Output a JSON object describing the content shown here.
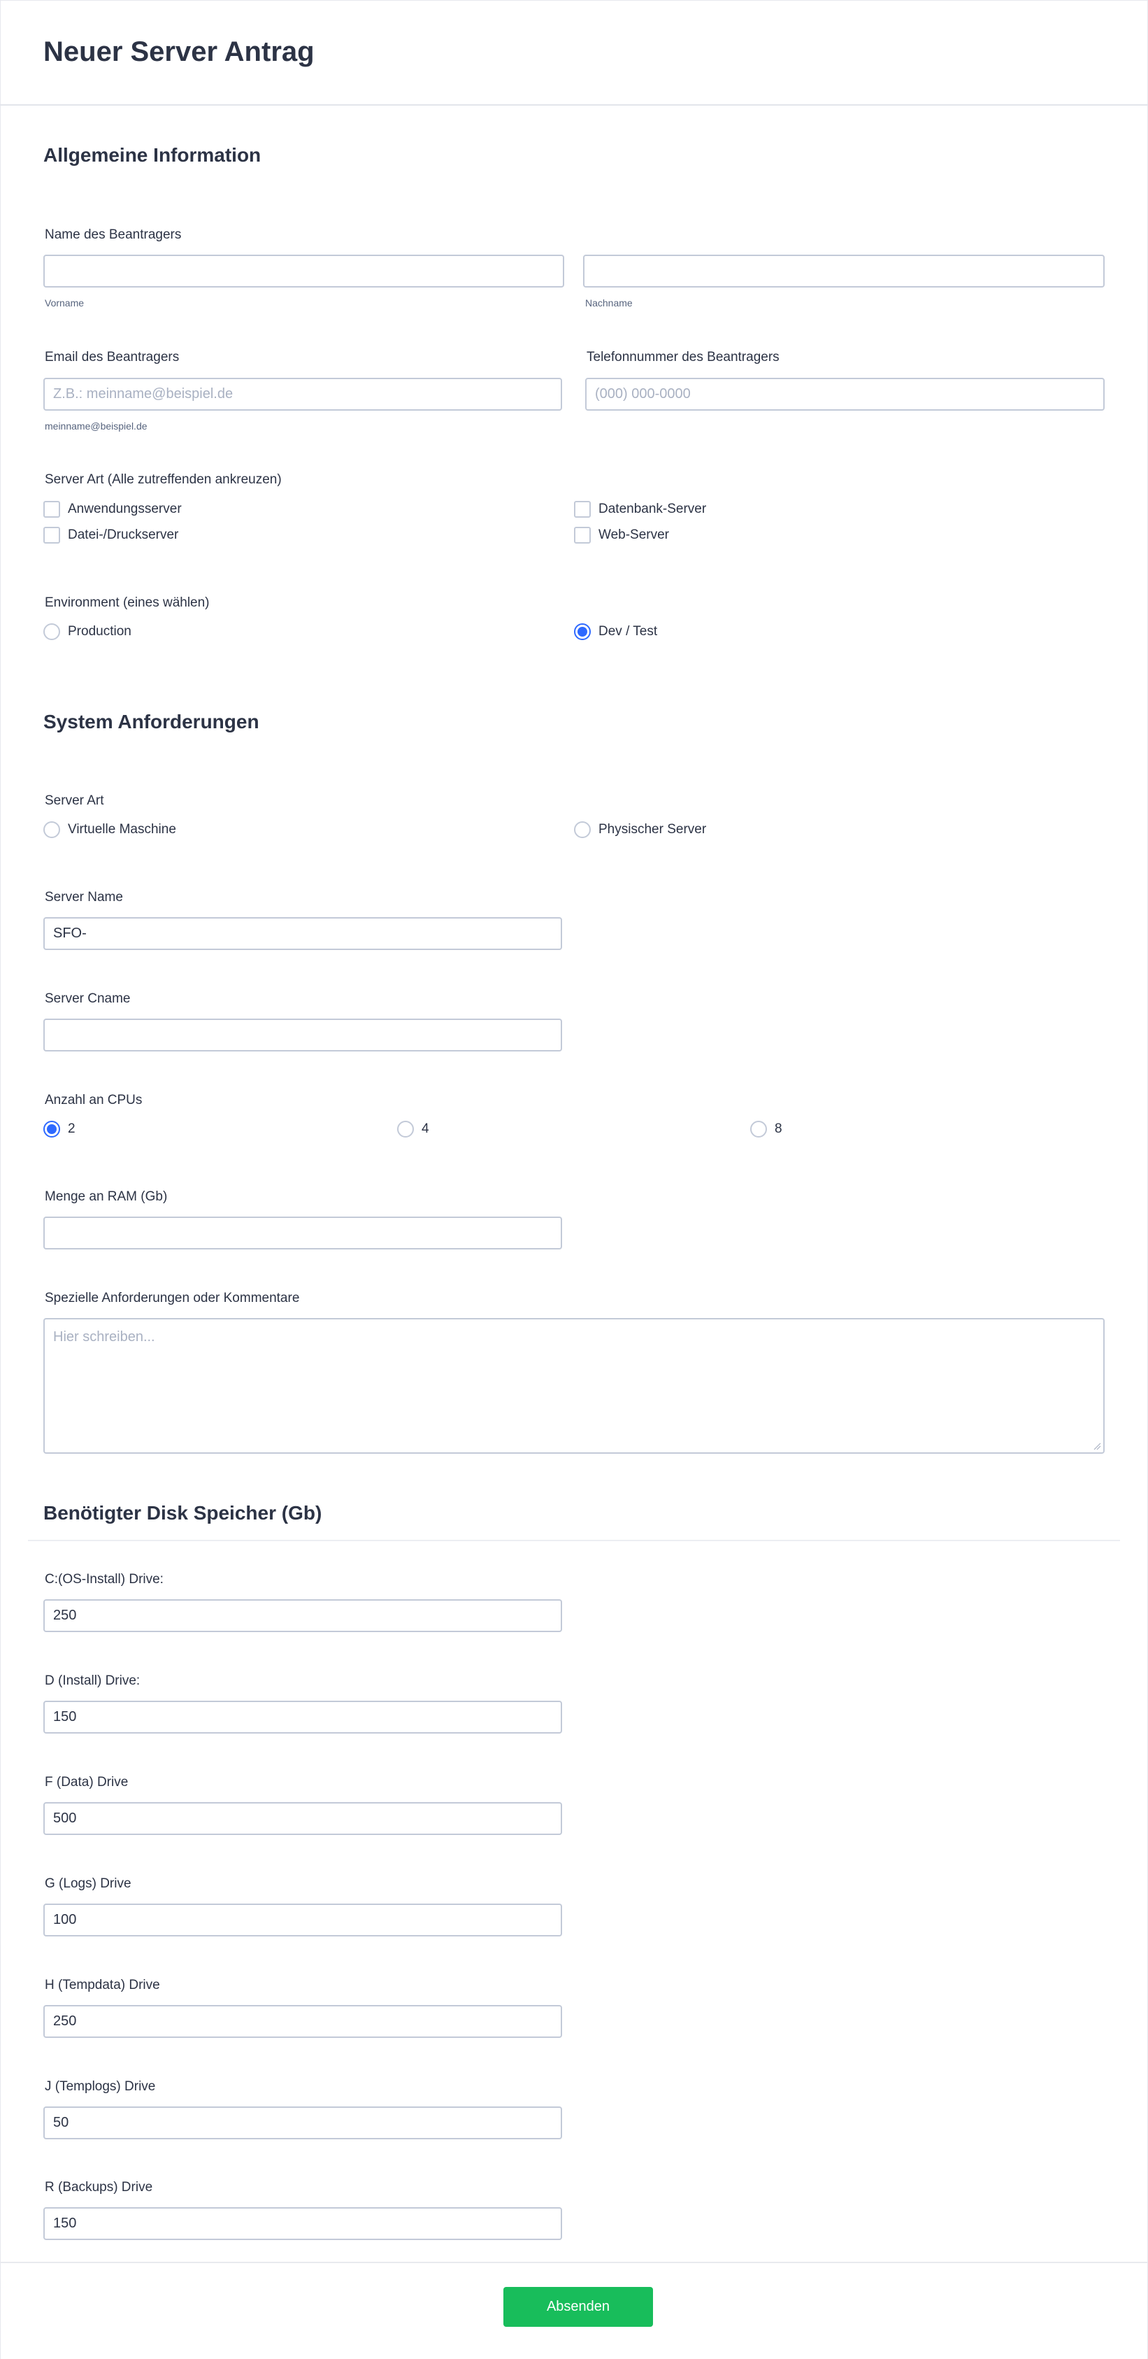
{
  "header": {
    "title": "Neuer Server Antrag"
  },
  "general": {
    "title": "Allgemeine Information",
    "name": {
      "label": "Name des Beantragers",
      "first_value": "",
      "last_value": "",
      "first_sublabel": "Vorname",
      "last_sublabel": "Nachname"
    },
    "email": {
      "label": "Email des Beantragers",
      "value": "",
      "placeholder": "Z.B.: meinname@beispiel.de",
      "sublabel": "meinname@beispiel.de"
    },
    "phone": {
      "label": "Telefonnummer des Beantragers",
      "value": "",
      "placeholder": "(000) 000-0000"
    },
    "server_type": {
      "label": "Server Art (Alle zutreffenden ankreuzen)",
      "options": [
        "Anwendungsserver",
        "Datenbank-Server",
        "Datei-/Druckserver",
        "Web-Server"
      ],
      "checked": [
        false,
        false,
        false,
        false
      ]
    },
    "environment": {
      "label": "Environment (eines wählen)",
      "options": [
        "Production",
        "Dev / Test"
      ],
      "selected": "Dev / Test"
    }
  },
  "system": {
    "title": "System Anforderungen",
    "server_kind": {
      "label": "Server Art",
      "options": [
        "Virtuelle Maschine",
        "Physischer Server"
      ],
      "selected": null
    },
    "server_name": {
      "label": "Server Name",
      "value": "SFO-"
    },
    "server_cname": {
      "label": "Server Cname",
      "value": ""
    },
    "cpus": {
      "label": "Anzahl an CPUs",
      "options": [
        "2",
        "4",
        "8"
      ],
      "selected": "2"
    },
    "ram": {
      "label": "Menge an RAM (Gb)",
      "value": ""
    },
    "comments": {
      "label": "Spezielle Anforderungen oder Kommentare",
      "value": "",
      "placeholder": "Hier schreiben..."
    }
  },
  "disk": {
    "title": "Benötigter Disk Speicher (Gb)",
    "drives": [
      {
        "label": "C:(OS-Install) Drive:",
        "value": "250"
      },
      {
        "label": "D (Install) Drive:",
        "value": "150"
      },
      {
        "label": "F (Data) Drive",
        "value": "500"
      },
      {
        "label": "G (Logs) Drive",
        "value": "100"
      },
      {
        "label": "H (Tempdata) Drive",
        "value": "250"
      },
      {
        "label": "J (Templogs) Drive",
        "value": "50"
      },
      {
        "label": "R (Backups) Drive",
        "value": "150"
      }
    ]
  },
  "footer": {
    "submit_label": "Absenden"
  },
  "colors": {
    "accent": "#2e69ff",
    "submit": "#18bd5b",
    "text": "#2c3345",
    "border": "#c3cad8"
  }
}
